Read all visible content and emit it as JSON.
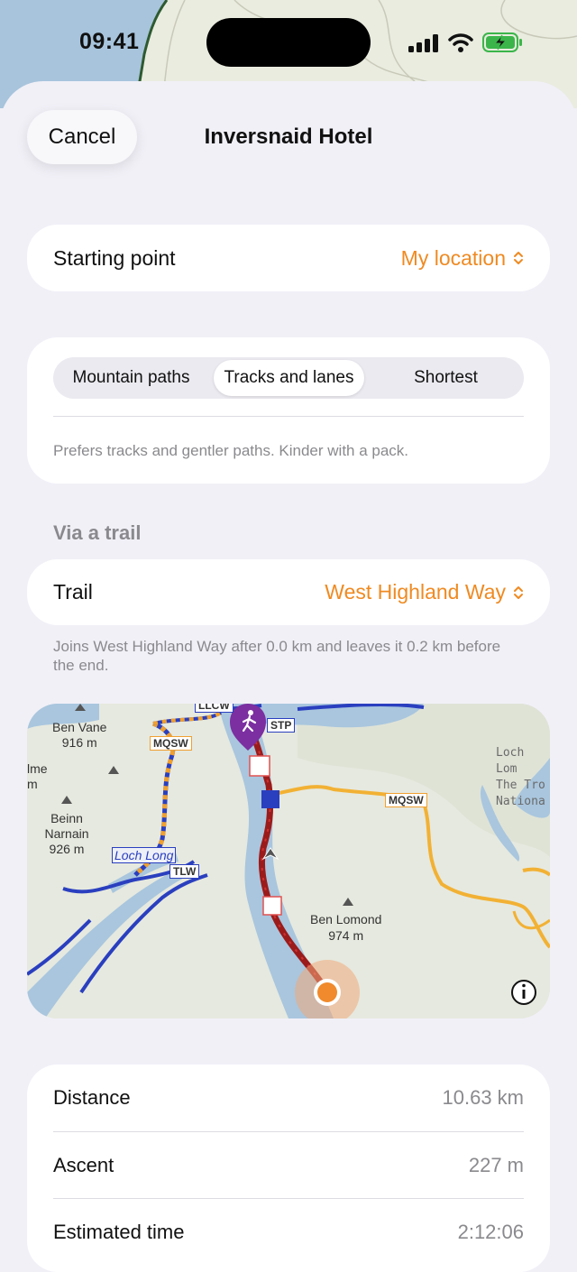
{
  "status": {
    "time": "09:41"
  },
  "header": {
    "cancel_label": "Cancel",
    "title": "Inversnaid Hotel"
  },
  "start": {
    "label": "Starting point",
    "value": "My location"
  },
  "route_mode": {
    "options": [
      "Mountain paths",
      "Tracks and lanes",
      "Shortest"
    ],
    "selected": "Tracks and lanes",
    "description": "Prefers tracks and gentler paths. Kinder with a pack."
  },
  "trail": {
    "section_label": "Via a trail",
    "label": "Trail",
    "value": "West Highland Way",
    "note": "Joins West Highland Way after 0.0 km and leaves it 0.2 km before the end."
  },
  "map": {
    "labels": {
      "ben_vane": "Ben Vane",
      "ben_vane_h": "916 m",
      "beinn_narnain": "Beinn Narnain",
      "beinn_narnain_h": "926 m",
      "ben_lomond": "Ben Lomond",
      "ben_lomond_h": "974 m",
      "loch_long": "Loch Long",
      "ime": "lme",
      "ime_m": "m",
      "np1": "Loch Lom",
      "np2": "The Tro",
      "np3": "Nationa",
      "mqsw1": "MQSW",
      "mqsw2": "MQSW",
      "tlw": "TLW",
      "llcw": "LLCW",
      "stp": "STP"
    },
    "route_color": "#9b1b1b",
    "start_pin_color": "#7b2fa0",
    "end_marker_color": "#f08a2c"
  },
  "stats": [
    {
      "label": "Distance",
      "value": "10.63 km"
    },
    {
      "label": "Ascent",
      "value": "227 m"
    },
    {
      "label": "Estimated time",
      "value": "2:12:06"
    }
  ]
}
